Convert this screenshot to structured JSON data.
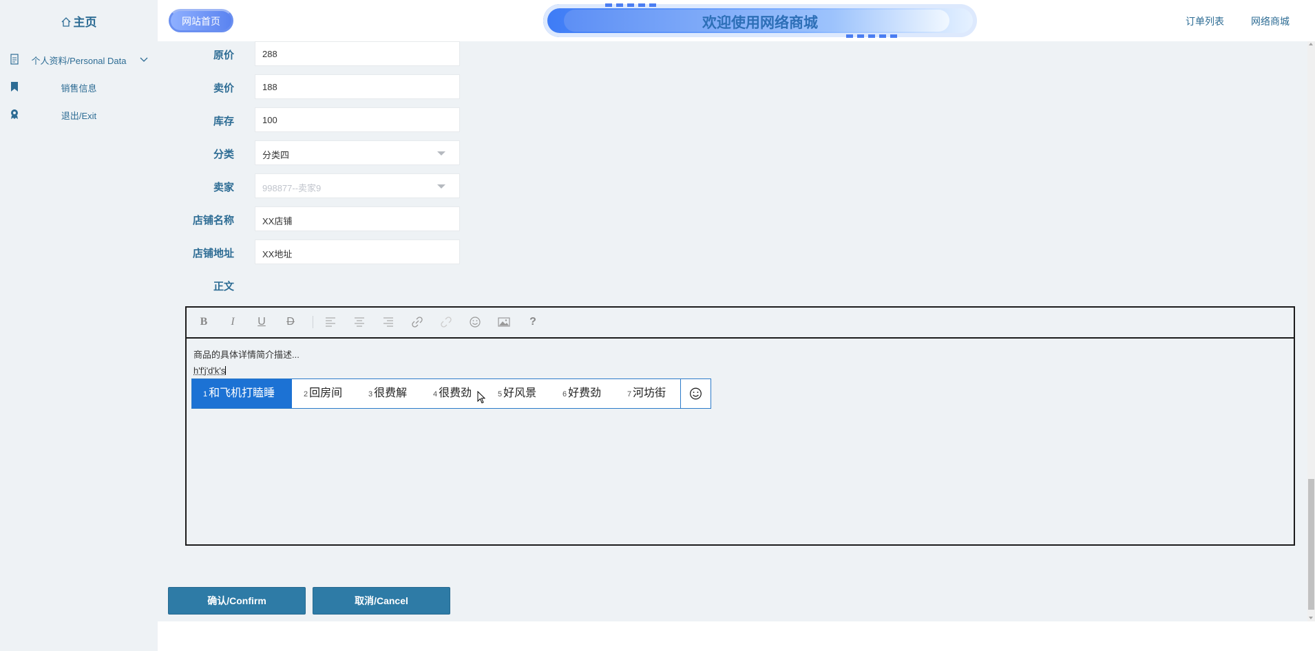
{
  "sidebar": {
    "home": "主页",
    "items": [
      {
        "label": "个人资料/Personal Data",
        "icon": "document-icon"
      },
      {
        "label": "销售信息",
        "icon": "bookmark-icon"
      },
      {
        "label": "退出/Exit",
        "icon": "badge-icon"
      }
    ]
  },
  "header": {
    "logo_text": "网站首页",
    "banner_title": "欢迎使用网络商城",
    "nav": [
      "订单列表",
      "网络商城"
    ]
  },
  "form": {
    "fields": [
      {
        "label": "原价",
        "value": "288"
      },
      {
        "label": "卖价",
        "value": "188"
      },
      {
        "label": "库存",
        "value": "100"
      },
      {
        "label": "分类",
        "value": "分类四"
      },
      {
        "label": "卖家",
        "value": "998877--卖家9"
      },
      {
        "label": "店铺名称",
        "value": "XX店铺"
      },
      {
        "label": "店铺地址",
        "value": "XX地址"
      }
    ],
    "body_label": "正文"
  },
  "editor": {
    "toolbar": [
      "bold-icon",
      "italic-icon",
      "underline-icon",
      "strikethrough-icon",
      "align-left-icon",
      "align-center-icon",
      "align-right-icon",
      "link-icon",
      "unlink-icon",
      "emoji-icon",
      "image-icon",
      "help-icon"
    ],
    "content_line1": "商品的具体详情简介描述...",
    "content_line2": "h'f'j'd'k's"
  },
  "ime": {
    "candidates": [
      {
        "num": "1",
        "text": "和飞机打瞌睡"
      },
      {
        "num": "2",
        "text": "回房间"
      },
      {
        "num": "3",
        "text": "很费解"
      },
      {
        "num": "4",
        "text": "很费劲"
      },
      {
        "num": "5",
        "text": "好风景"
      },
      {
        "num": "6",
        "text": "好费劲"
      },
      {
        "num": "7",
        "text": "河坊街"
      }
    ],
    "selected_index": 0
  },
  "buttons": {
    "confirm": "确认/Confirm",
    "cancel": "取消/Cancel"
  },
  "colors": {
    "accent": "#2d6c94",
    "button": "#2e7ba6",
    "ime_selected": "#1c72d4",
    "background": "#eef2f5"
  }
}
